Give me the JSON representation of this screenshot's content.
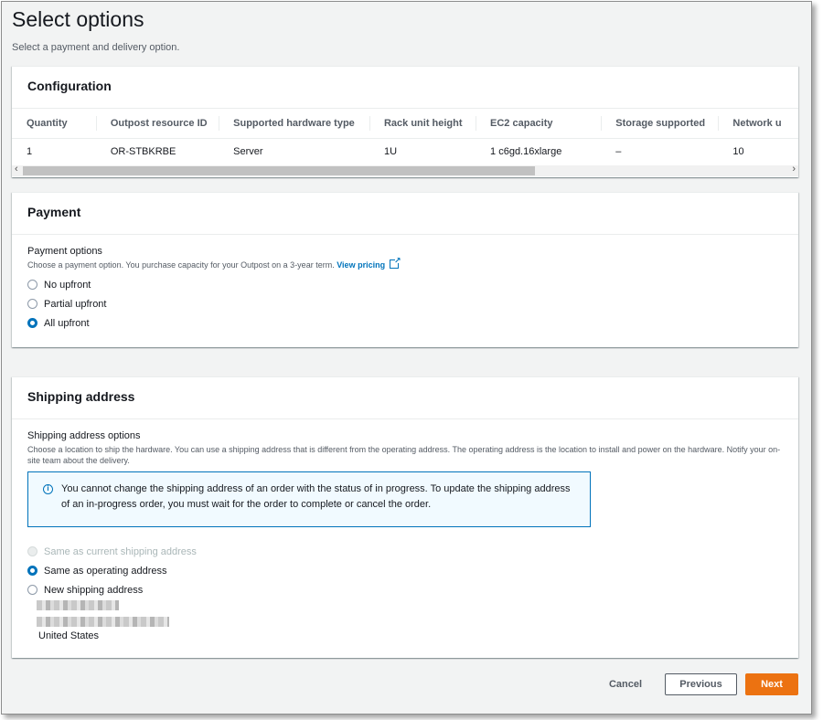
{
  "page": {
    "title": "Select options",
    "description": "Select a payment and delivery option."
  },
  "configuration": {
    "title": "Configuration",
    "columns": [
      "Quantity",
      "Outpost resource ID",
      "Supported hardware type",
      "Rack unit height",
      "EC2 capacity",
      "Storage supported",
      "Network u"
    ],
    "row": [
      "1",
      "OR-STBKRBE",
      "Server",
      "1U",
      "1 c6gd.16xlarge",
      "–",
      "10"
    ]
  },
  "payment": {
    "title": "Payment",
    "field_label": "Payment options",
    "field_desc": "Choose a payment option. You purchase capacity for your Outpost on a 3-year term.",
    "link_label": "View pricing",
    "options": [
      {
        "label": "No upfront",
        "checked": false
      },
      {
        "label": "Partial upfront",
        "checked": false
      },
      {
        "label": "All upfront",
        "checked": true
      }
    ]
  },
  "shipping": {
    "title": "Shipping address",
    "field_label": "Shipping address options",
    "field_desc": "Choose a location to ship the hardware. You can use a shipping address that is different from the operating address. The operating address is the location to install and power on the hardware. Notify your on-site team about the delivery.",
    "info_text": "You cannot change the shipping address of an order with the status of in progress. To update the shipping address of an in-progress order, you must wait for the order to complete or cancel the order.",
    "options": [
      {
        "label": "Same as current shipping address",
        "checked": false,
        "disabled": true
      },
      {
        "label": "Same as operating address",
        "checked": true,
        "disabled": false
      },
      {
        "label": "New shipping address",
        "checked": false,
        "disabled": false
      }
    ],
    "address_country": "United States"
  },
  "footer": {
    "cancel_label": "Cancel",
    "previous_label": "Previous",
    "next_label": "Next"
  },
  "colors": {
    "accent": "#0073bb",
    "primary_button": "#ec7211"
  }
}
